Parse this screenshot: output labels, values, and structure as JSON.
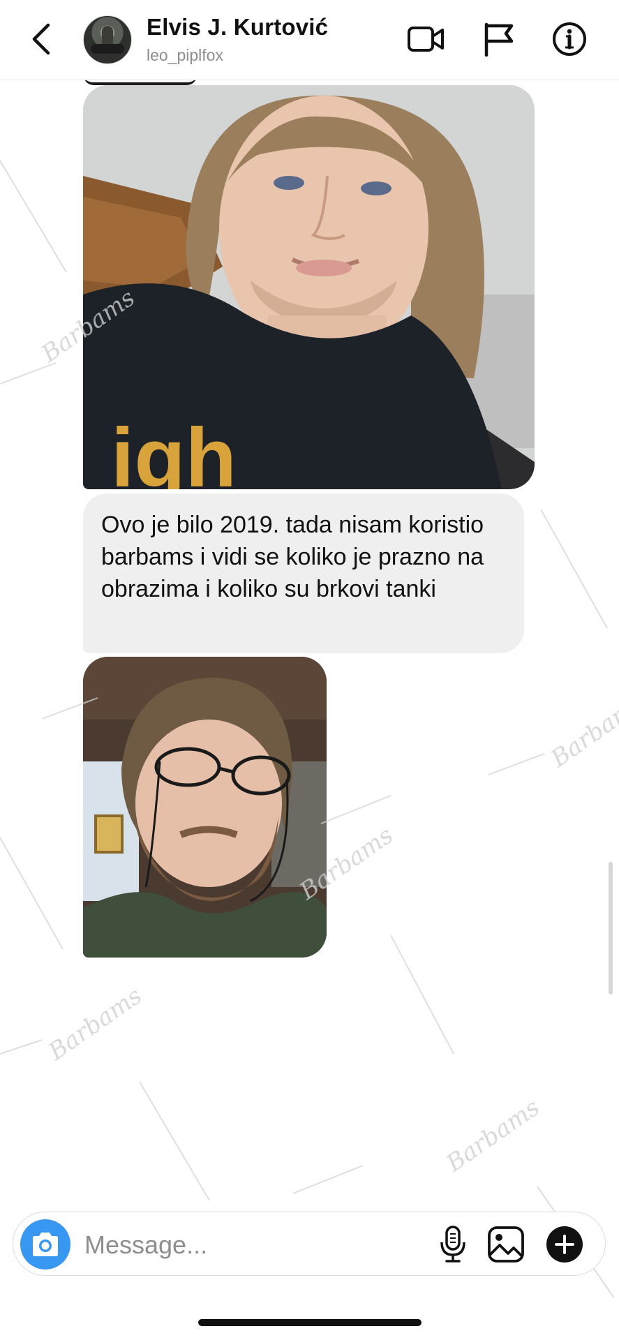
{
  "header": {
    "name": "Elvis J. Kurtović",
    "username": "leo_piplfox",
    "icons": [
      "back-chevron-icon",
      "video-call-icon",
      "flag-icon",
      "info-icon"
    ]
  },
  "messages": [
    {
      "type": "photo",
      "icon": "selfie-photo-long-hair",
      "shirt_text": "igh"
    },
    {
      "type": "text",
      "text": "Ovo je bilo 2019.  tada nisam koristio barbams i vidi se koliko je prazno na obrazima i koliko su brkovi tanki"
    },
    {
      "type": "photo",
      "icon": "selfie-photo-glasses-beard"
    }
  ],
  "composer": {
    "placeholder": "Message...",
    "icons": [
      "camera-icon",
      "microphone-icon",
      "gallery-icon",
      "plus-icon"
    ],
    "accent_color": "#3897f0"
  },
  "watermark": {
    "glyph": "Barbams"
  }
}
